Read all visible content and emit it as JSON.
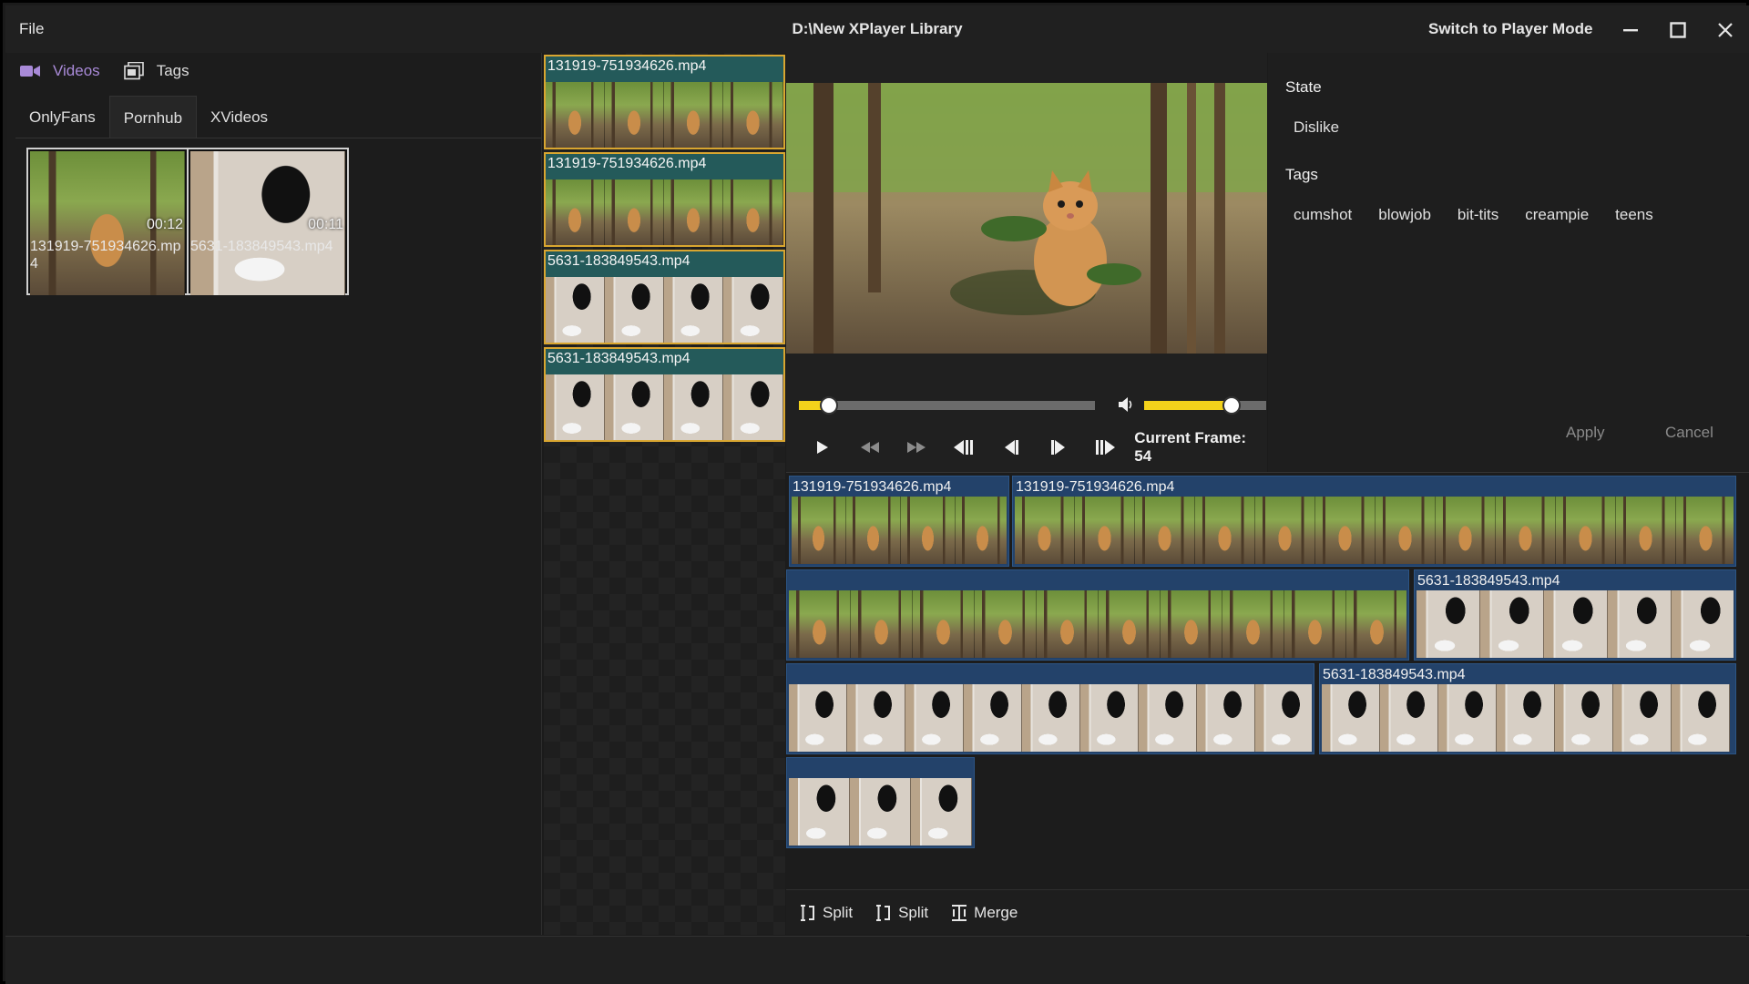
{
  "titlebar": {
    "file_menu": "File",
    "title": "D:\\New XPlayer Library",
    "switch_mode": "Switch to Player Mode"
  },
  "left_panel": {
    "nav": {
      "videos": "Videos",
      "tags": "Tags"
    },
    "tabs": [
      "OnlyFans",
      "Pornhub",
      "XVideos"
    ],
    "active_tab": "Pornhub",
    "items": [
      {
        "name": "131919-751934626.mp4",
        "duration": "00:12",
        "thumb": "cat"
      },
      {
        "name": "5631-183849543.mp4",
        "duration": "00:11",
        "thumb": "dog"
      }
    ]
  },
  "clip_list": [
    {
      "name": "131919-751934626.mp4",
      "thumb": "cat"
    },
    {
      "name": "131919-751934626.mp4",
      "thumb": "cat"
    },
    {
      "name": "5631-183849543.mp4",
      "thumb": "dog"
    },
    {
      "name": "5631-183849543.mp4",
      "thumb": "dog"
    }
  ],
  "player": {
    "seek_fraction": 0.1,
    "volume_fraction": 0.72,
    "current_frame_label": "Current Frame: 54"
  },
  "details": {
    "state_heading": "State",
    "state_value": "Dislike",
    "tags_heading": "Tags",
    "tags": [
      "cumshot",
      "blowjob",
      "bit-tits",
      "creampie",
      "teens"
    ],
    "apply": "Apply",
    "cancel": "Cancel"
  },
  "timeline": {
    "clips": [
      {
        "name": "131919-751934626.mp4",
        "thumb": "cat"
      },
      {
        "name": "131919-751934626.mp4",
        "thumb": "cat"
      },
      {
        "name": "",
        "thumb": "cat"
      },
      {
        "name": "5631-183849543.mp4",
        "thumb": "dog"
      },
      {
        "name": "",
        "thumb": "dog"
      },
      {
        "name": "5631-183849543.mp4",
        "thumb": "dog"
      },
      {
        "name": "",
        "thumb": "dog"
      }
    ],
    "tools": [
      "Split",
      "Split",
      "Merge"
    ]
  },
  "colors": {
    "accent_purple": "#a98ad8",
    "clip_border_gold": "#d9a630",
    "slider_yellow": "#f3d21b",
    "timeline_clip_blue": "#23426a"
  }
}
